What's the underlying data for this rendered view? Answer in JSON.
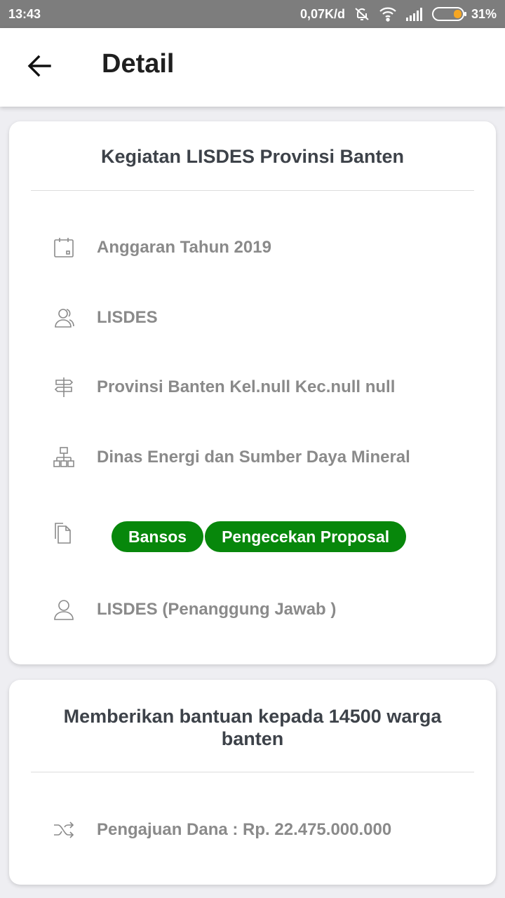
{
  "status_bar": {
    "time": "13:43",
    "net_speed": "0,07K/d",
    "battery_percent": "31%",
    "icons": [
      "mute-icon",
      "wifi-icon",
      "signal-icon",
      "battery-icon"
    ],
    "battery_level": 0.31,
    "battery_color": "#f5a623"
  },
  "app_bar": {
    "back_icon": "back-arrow-icon",
    "title": "Detail"
  },
  "card1": {
    "title": "Kegiatan LISDES Provinsi Banten",
    "rows": [
      {
        "icon": "calendar-icon",
        "text": "Anggaran Tahun 2019"
      },
      {
        "icon": "users-icon",
        "text": "LISDES"
      },
      {
        "icon": "signpost-icon",
        "text": "Provinsi Banten Kel.null Kec.null null"
      },
      {
        "icon": "sitemap-icon",
        "text": "Dinas Energi dan Sumber Daya Mineral"
      },
      {
        "icon": "documents-icon",
        "chips": [
          "Bansos",
          "Pengecekan Proposal"
        ]
      },
      {
        "icon": "user-icon",
        "text": "LISDES (Penanggung Jawab )"
      }
    ]
  },
  "card2": {
    "title": "Memberikan bantuan kepada 14500 warga banten",
    "rows": [
      {
        "icon": "shuffle-icon",
        "text": "Pengajuan Dana : Rp. 22.475.000.000"
      }
    ]
  },
  "colors": {
    "chip_green": "#07870b",
    "text_gray": "#8a8a8a",
    "title_dark": "#3d4249",
    "status_bar": "#7d7d7d"
  }
}
